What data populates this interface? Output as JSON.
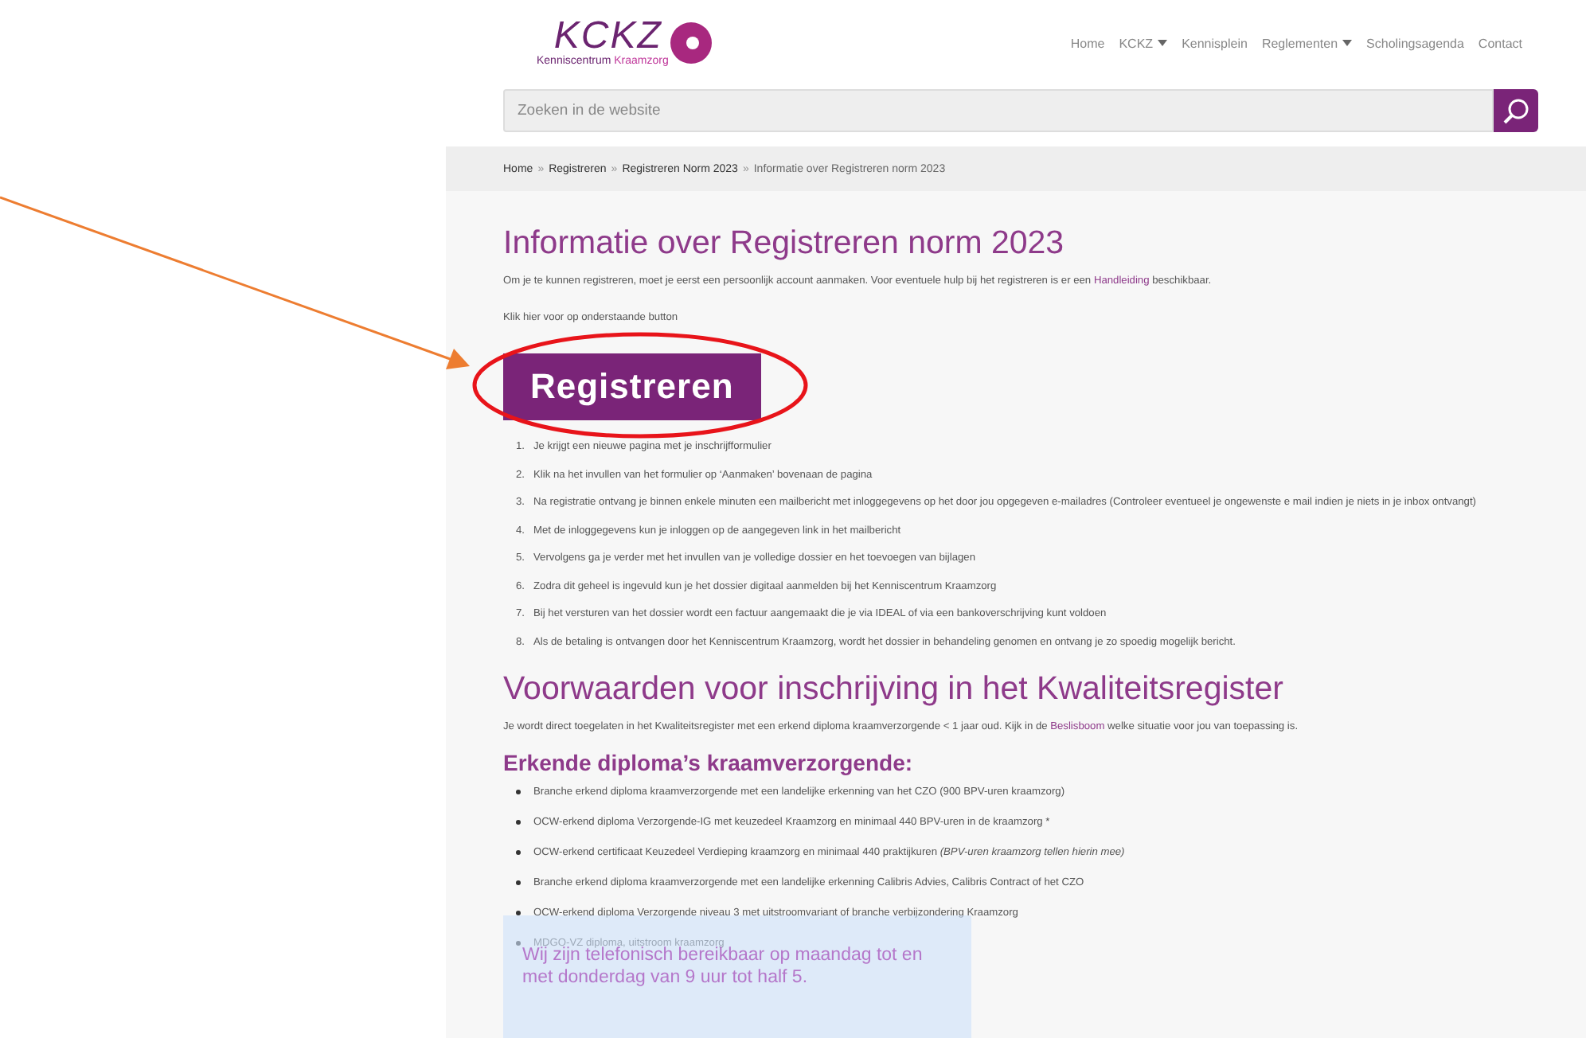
{
  "logo": {
    "mark": "KCKZ",
    "line_start": "Kenniscentrum ",
    "line_end": "Kraamzorg"
  },
  "nav": [
    {
      "label": "Home",
      "has_dropdown": false
    },
    {
      "label": "KCKZ",
      "has_dropdown": true
    },
    {
      "label": "Kennisplein",
      "has_dropdown": false
    },
    {
      "label": "Reglementen",
      "has_dropdown": true
    },
    {
      "label": "Scholingsagenda",
      "has_dropdown": false
    },
    {
      "label": "Contact",
      "has_dropdown": false
    }
  ],
  "search": {
    "placeholder": "Zoeken in de website"
  },
  "breadcrumb": [
    {
      "label": "Home",
      "sep": "»"
    },
    {
      "label": "Registreren",
      "sep": "»"
    },
    {
      "label": "Registreren Norm 2023",
      "sep": "»"
    },
    {
      "label": "Informatie over Registreren norm 2023"
    }
  ],
  "title": "Informatie over Registreren norm 2023",
  "intro": {
    "before": "Om je te kunnen registreren, moet je eerst een persoonlijk account aanmaken. Voor eventuele hulp bij het registreren is er een ",
    "link": "Handleiding",
    "after": " beschikbaar."
  },
  "instruction": "Klik hier voor op onderstaande button",
  "register_button": "Registreren",
  "steps": [
    {
      "number": "1.",
      "text": "Je krijgt een nieuwe pagina met je inschrijfformulier"
    },
    {
      "number": "2.",
      "text": "Klik na het invullen van het formulier op ‘Aanmaken’ bovenaan de pagina"
    },
    {
      "number": "3.",
      "text": "Na registratie ontvang je binnen enkele minuten een mailbericht met inloggegevens op het door jou opgegeven e-mailadres (Controleer eventueel je ongewenste e mail indien je niets in je inbox ontvangt)"
    },
    {
      "number": "4.",
      "text": "Met de inloggegevens kun je inloggen op de aangegeven link in het mailbericht"
    },
    {
      "number": "5.",
      "text": "Vervolgens ga je verder met het invullen van je volledige dossier en het toevoegen van bijlagen"
    },
    {
      "number": "6.",
      "text": "Zodra dit geheel is ingevuld kun je het dossier digitaal aanmelden bij het Kenniscentrum Kraamzorg"
    },
    {
      "number": "7.",
      "text": "Bij het versturen van het dossier wordt een factuur aangemaakt die je via IDEAL of via een bankoverschrijving kunt voldoen"
    },
    {
      "number": "8.",
      "text": "Als de betaling is ontvangen door het Kenniscentrum Kraamzorg, wordt het dossier in behandeling genomen en ontvang je zo spoedig mogelijk bericht."
    }
  ],
  "section_title": "Voorwaarden voor inschrijving in het Kwaliteitsregister",
  "section_intro": {
    "before": "Je wordt direct toegelaten in het Kwaliteitsregister met een erkend diploma kraamverzorgende < 1 jaar oud. Kijk in de ",
    "link": "Beslisboom",
    "after": " welke situatie voor jou van toepassing is."
  },
  "subsection_title": "Erkende diploma’s kraamverzorgende:",
  "diplomas": [
    "Branche erkend diploma kraamverzorgende met een landelijke erkenning van het CZO (900 BPV-uren kraamzorg)",
    "OCW-erkend diploma Verzorgende-IG met keuzedeel Kraamzorg en minimaal 440 BPV-uren in de kraamzorg *",
    "OCW-erkend certificaat Keuzedeel Verdieping kraamzorg en minimaal 440 praktijkuren *(BPV-uren kraamzorg tellen hierin mee)*",
    "Branche erkend diploma kraamverzorgende met een landelijke erkenning Calibris Advies, Calibris Contract of het CZO",
    "OCW-erkend diploma Verzorgende niveau 3 met uitstroomvariant of branche verbijzondering Kraamzorg",
    "MDGO-VZ diploma, uitstroom kraamzorg"
  ],
  "notice": "Wij zijn telefonisch bereikbaar op maandag tot en met donderdag van 9 uur tot half 5."
}
